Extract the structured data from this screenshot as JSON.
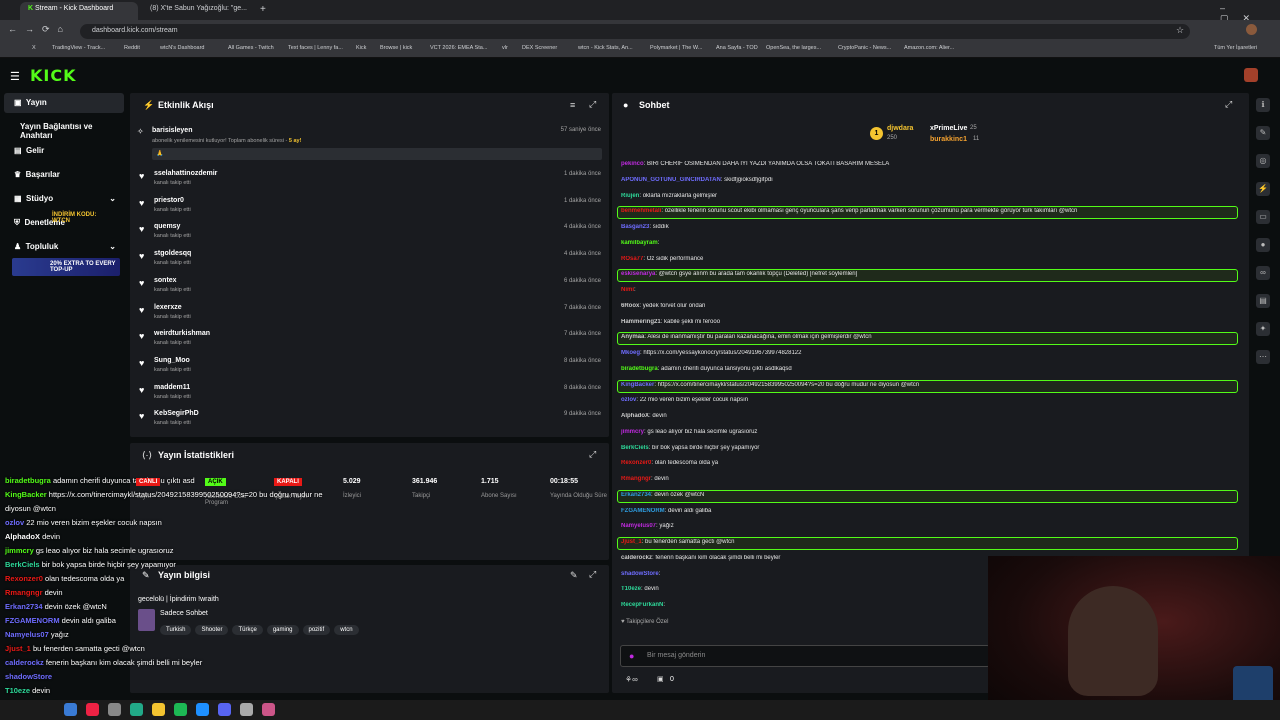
{
  "browser": {
    "tabs": [
      "Stream - Kick Dashboard",
      "(8) X'te Sabun Yağızoğlu: \"ge..."
    ],
    "new_tab": "+",
    "url": "dashboard.kick.com/stream",
    "bookmarks": [
      "X",
      "TradingView - Track...",
      "Reddit",
      "wtcN's Dashboard",
      "All Games - Twitch",
      "Text faces | Lenny fa...",
      "Kick",
      "Browse | kick",
      "VCT 2026: EMEA Sta...",
      "vlr",
      "DEX Screener",
      "wtcn - Kick Stats, An...",
      "Polymarket | The W...",
      "Ana Sayfa - TOD",
      "OpenSea, the larges...",
      "CryptoPanic - News...",
      "Amazon.com: Alier...",
      "Tüm Yer İşaretleri"
    ]
  },
  "site": {
    "logo": "KICK"
  },
  "sidebar": {
    "items": [
      {
        "label": "Yayın",
        "icon": "video-icon"
      },
      {
        "label": "Yayın Bağlantısı ve Anahtarı",
        "icon": ""
      },
      {
        "label": "Gelir",
        "icon": "money-icon"
      },
      {
        "label": "Başarılar",
        "icon": "trophy-icon"
      },
      {
        "label": "Stüdyo",
        "icon": "studio-icon"
      },
      {
        "label": "Denetleme",
        "icon": "shield-icon"
      },
      {
        "label": "Topluluk",
        "icon": "community-icon"
      }
    ],
    "promo_code_label": "İNDİRİM KODU: WTCN",
    "promo_banner": "20% EXTRA TO EVERY TOP-UP"
  },
  "activity": {
    "title": "Etkinlik Akışı",
    "sub_event": {
      "user": "barisisleyen",
      "time": "57 saniye önce",
      "text": "abonelik yenilemesini kutluyor! Toplam abonelik süresi - ",
      "months": "5 ay!",
      "message": "🙏"
    },
    "follows": [
      {
        "user": "sselahattinozdemir",
        "action": "kanalı takip etti",
        "time": "1 dakika önce"
      },
      {
        "user": "priestor0",
        "action": "kanalı takip etti",
        "time": "1 dakika önce"
      },
      {
        "user": "quemsy",
        "action": "kanalı takip etti",
        "time": "4 dakika önce"
      },
      {
        "user": "stgoldesqq",
        "action": "kanalı takip etti",
        "time": "4 dakika önce"
      },
      {
        "user": "sontex",
        "action": "kanalı takip etti",
        "time": "6 dakika önce"
      },
      {
        "user": "lexerxze",
        "action": "kanalı takip etti",
        "time": "7 dakika önce"
      },
      {
        "user": "weirdturkishman",
        "action": "kanalı takip etti",
        "time": "7 dakika önce"
      },
      {
        "user": "Sung_Moo",
        "action": "kanalı takip etti",
        "time": "8 dakika önce"
      },
      {
        "user": "maddem11",
        "action": "kanalı takip etti",
        "time": "8 dakika önce"
      },
      {
        "user": "KebSegirPhD",
        "action": "kanalı takip etti",
        "time": "9 dakika önce"
      }
    ]
  },
  "stats": {
    "title": "Yayın İstatistikleri",
    "badges": [
      {
        "label": "CANLI",
        "color": "#e91916"
      },
      {
        "label": "AÇIK",
        "color": "#53fc18"
      },
      {
        "label": "KAPALI",
        "color": "#e91916"
      }
    ],
    "badge_captions": [
      "Yayın",
      "Abonelere Özel Program",
      "Çıplak Yayın"
    ],
    "items": [
      {
        "value": "5.029",
        "label": "İzleyici"
      },
      {
        "value": "361.946",
        "label": "Takipçi"
      },
      {
        "value": "1.715",
        "label": "Abone Sayısı"
      },
      {
        "value": "00:18:55",
        "label": "Yayında Olduğu Süre"
      }
    ]
  },
  "stream_info": {
    "title": "Yayın bilgisi",
    "stream_title": "gecelolü | İpindirim !wraith",
    "category": "Sadece Sohbet",
    "tags": [
      "Turkish",
      "Shooter",
      "Türkçe",
      "gaming",
      "pozitif",
      "wtcn"
    ]
  },
  "chat": {
    "title": "Sohbet",
    "gifters": {
      "rank1": "djwdara",
      "rank1_count": "250",
      "rank2": "xPrimeLive",
      "rank2_count": "25",
      "rank3": "burakkinc1",
      "rank3_count": "11"
    },
    "messages": [
      {
        "user": "pekinco",
        "color": "#c02ae0",
        "text": "BİRİ CHERİF OSİMENDAN DAHA İYİ YAZDI YANIMDA OLSA TOKATI BASARIM MESELA",
        "hl": false
      },
      {
        "user": "APONUN_GOTUNU_GINCIRDATAN",
        "color": "#6f6dff",
        "text": "skidfjgioksdfjgifpdı",
        "hl": false
      },
      {
        "user": "Riujen",
        "color": "#2ed99a",
        "text": "oklarla mızraklarla gelmişler",
        "hl": false
      },
      {
        "user": "benmehmetali",
        "color": "#e91916",
        "text": "özellikle fenerin sorunu scout ekibi olmaması genç oyunculara şans verip parlatmak varken sorunun çözümünü para vermekte görüyor türk takımları @wtcn",
        "hl": true
      },
      {
        "user": "Basgan23",
        "color": "#6f6dff",
        "text": "sıddık",
        "hl": false
      },
      {
        "user": "kamilbayram",
        "color": "#53fc18",
        "text": "",
        "hl": false
      },
      {
        "user": "ROsa77",
        "color": "#e91916",
        "text": "Öz sidik performance",
        "hl": false
      },
      {
        "user": "eskisenarya",
        "color": "#c02ae0",
        "text": "@wtcn gsye alınm bu arada tam okanlık topçu (Deleted) [nefret söylemleri]",
        "hl": true
      },
      {
        "user": "Nimi",
        "color": "#e91916",
        "text": "",
        "hl": false
      },
      {
        "user": "6Roox",
        "color": "#cccccc",
        "text": "yedek forvet olur ondan",
        "hl": false
      },
      {
        "user": "Hammering21",
        "color": "#cccccc",
        "text": "kabile şekli mi ferooo",
        "hl": false
      },
      {
        "user": "Anymaa",
        "color": "#cccccc",
        "text": "Alesi de inanmamıştır bu paraları kazanacağına, emin olmak için gelmişlerdir @wtcn",
        "hl": true
      },
      {
        "user": "Mkoeg",
        "color": "#6f6dff",
        "text": "https://x.com/yessaykonocry/status/2049196739974828122",
        "hl": false
      },
      {
        "user": "biradetbugra",
        "color": "#53fc18",
        "text": "adamın cherifi duyunca tansiyonu çıktı asdlkaqsd",
        "hl": false
      },
      {
        "user": "KingBacker",
        "color": "#6f6dff",
        "text": "https://x.com/tinercimaykl/status/2049215839950250094?s=20 bu doğru mudur ne diyosun @wtcn",
        "hl": true
      },
      {
        "user": "ozlov",
        "color": "#6f6dff",
        "text": "22 mio veren bizim eşekler cocuk napsın",
        "hl": false
      },
      {
        "user": "AlphadoX",
        "color": "#cccccc",
        "text": "devin",
        "hl": false
      },
      {
        "user": "jimmcry",
        "color": "#c02ae0",
        "text": "gs leao alıyor biz hala secimle ugrasıoruz",
        "hl": false
      },
      {
        "user": "BerkCiels",
        "color": "#2ed99a",
        "text": "bir bok yapsa birde hiçbir şey yapamıyor",
        "hl": false
      },
      {
        "user": "Rexonzer0",
        "color": "#e91916",
        "text": "olan tedescoma olda ya",
        "hl": false
      },
      {
        "user": "Rmangngr",
        "color": "#e91916",
        "text": "devin",
        "hl": false
      },
      {
        "user": "Erkan2734",
        "color": "#2e9de0",
        "text": "devin özek @wtcN",
        "hl": true
      },
      {
        "user": "FZGAMENORM",
        "color": "#2e9de0",
        "text": "devin aldı galiba",
        "hl": false
      },
      {
        "user": "Namyelus07",
        "color": "#c02ae0",
        "text": "yağız",
        "hl": false
      },
      {
        "user": "Jjust_1",
        "color": "#e91916",
        "text": "bu fenerden samatta gecti @wtcn",
        "hl": true
      },
      {
        "user": "calderockz",
        "color": "#cccccc",
        "text": "fenerin başkanı kim olacak şimdi belli mi beyler",
        "hl": false
      },
      {
        "user": "shadowStore",
        "color": "#6f6dff",
        "text": "",
        "hl": false
      },
      {
        "user": "T10eze",
        "color": "#2ed99a",
        "text": "devin",
        "hl": false
      },
      {
        "user": "RecepFurkanN",
        "color": "#2ed99a",
        "text": "",
        "hl": false
      }
    ],
    "followers_only": "Takipçilere Özel",
    "input_placeholder": "Bir mesaj gönderin",
    "points": "0"
  },
  "overlay_chat": [
    {
      "user": "biradetbugra",
      "text": "adamın cherifi duyunca tansiyonu çıktı asd",
      "color": "#53fc18"
    },
    {
      "user": "KingBacker",
      "text": "https://x.com/tinercimaykl/status/2049215839950250094?s=20 bu doğru mudur ne",
      "color": "#53fc18"
    },
    {
      "user": "",
      "text": "diyosun @wtcn",
      "color": "#ffffff"
    },
    {
      "user": "ozlov",
      "text": "22 mio veren bizim eşekler cocuk napsın",
      "color": "#6f6dff"
    },
    {
      "user": "AlphadoX",
      "text": "devin",
      "color": "#ffffff"
    },
    {
      "user": "jimmcry",
      "text": "gs leao alıyor biz hala secimle ugrasıoruz",
      "color": "#53fc18"
    },
    {
      "user": "BerkCiels",
      "text": "bir bok yapsa birde hiçbir şey yapamıyor",
      "color": "#2ed99a"
    },
    {
      "user": "Rexonzer0",
      "text": "olan tedescoma olda ya",
      "color": "#e91916"
    },
    {
      "user": "Rmangngr",
      "text": "devin",
      "color": "#e91916"
    },
    {
      "user": "Erkan2734",
      "text": "devin özek @wtcN",
      "color": "#6f6dff"
    },
    {
      "user": "FZGAMENORM",
      "text": "devin aldı galiba",
      "color": "#6f6dff"
    },
    {
      "user": "Namyelus07",
      "text": "yağız",
      "color": "#6f6dff"
    },
    {
      "user": "Jjust_1",
      "text": "bu fenerden samatta gecti @wtcn",
      "color": "#e91916"
    },
    {
      "user": "calderockz",
      "text": "fenerin başkanı kim olacak şimdi belli mi beyler",
      "color": "#6f6dff"
    },
    {
      "user": "shadowStore",
      "text": "",
      "color": "#6f6dff"
    },
    {
      "user": "T10eze",
      "text": "devin",
      "color": "#2ed99a"
    },
    {
      "user": "RecepFurkanN",
      "text": "",
      "color": "#2ed99a"
    }
  ]
}
